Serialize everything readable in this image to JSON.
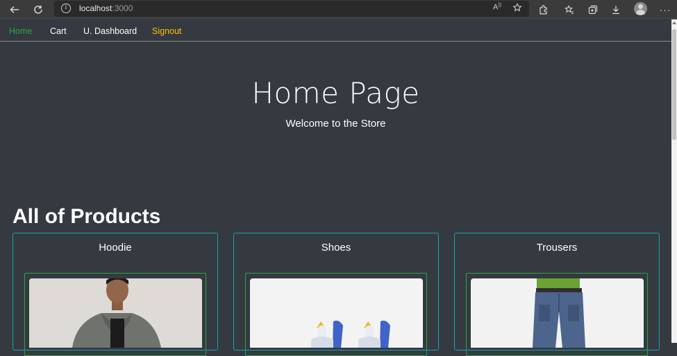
{
  "browser": {
    "url_host": "localhost",
    "url_port": ":3000"
  },
  "nav": {
    "home": "Home",
    "cart": "Cart",
    "dashboard": "U. Dashboard",
    "signout": "Signout"
  },
  "hero": {
    "title": "Home Page",
    "subtitle": "Welcome to the Store"
  },
  "products_section": {
    "title": "All of Products",
    "items": [
      {
        "name": "Hoodie"
      },
      {
        "name": "Shoes"
      },
      {
        "name": "Trousers"
      }
    ]
  },
  "colors": {
    "background": "#343a40",
    "home_link": "#28a745",
    "signout_link": "#ffc107",
    "card_border": "#17a2b8",
    "image_border": "#28a745"
  }
}
